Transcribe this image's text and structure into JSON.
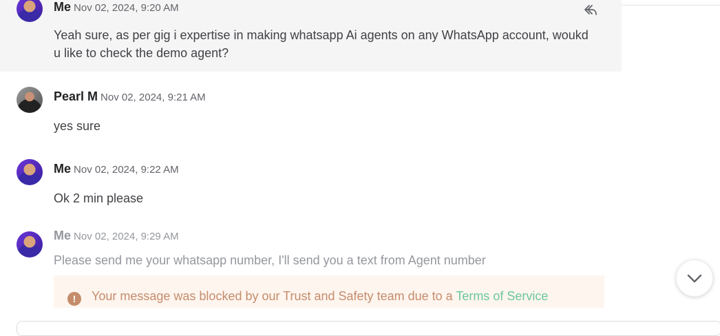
{
  "messages": [
    {
      "sender": "Me",
      "time": "Nov 02, 2024, 9:20 AM",
      "text": "Yeah sure, as per gig i expertise in making whatsapp Ai agents on any WhatsApp account, woukd u like to check the demo agent?"
    },
    {
      "sender": "Pearl M",
      "time": "Nov 02, 2024, 9:21 AM",
      "text": "yes sure"
    },
    {
      "sender": "Me",
      "time": "Nov 02, 2024, 9:22 AM",
      "text": "Ok 2 min please"
    },
    {
      "sender": "Me",
      "time": "Nov 02, 2024, 9:29 AM",
      "text": "Please send me your whatsapp number, I'll send you a text from Agent number"
    }
  ],
  "blocked_notice": {
    "text": "Your message was blocked by our Trust and Safety team due to a ",
    "link": "Terms of Service"
  },
  "icons": {
    "reply": "reply-icon",
    "warning": "warning-icon",
    "scroll": "chevron-down-icon"
  },
  "colors": {
    "notice_text": "#c58c6b",
    "link": "#6bc79a",
    "highlight_bg": "#f5f5f5"
  }
}
